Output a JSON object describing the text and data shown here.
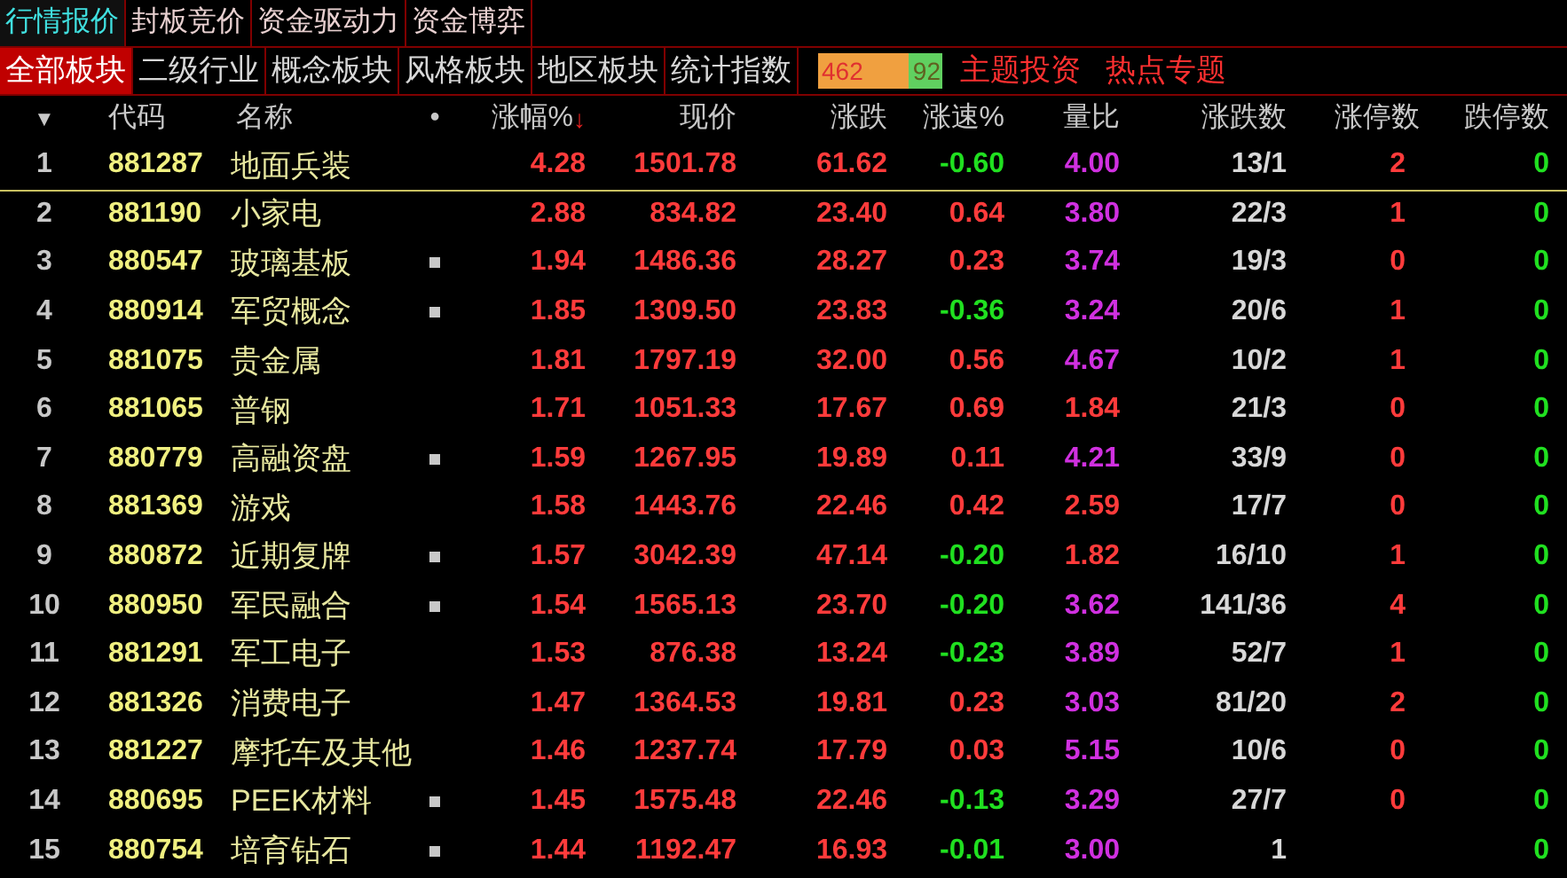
{
  "top_tabs": [
    {
      "label": "行情报价",
      "selected": true
    },
    {
      "label": "封板竞价",
      "selected": false
    },
    {
      "label": "资金驱动力",
      "selected": false
    },
    {
      "label": "资金博弈",
      "selected": false
    }
  ],
  "sector_tabs": [
    {
      "label": "全部板块",
      "selected": true
    },
    {
      "label": "二级行业",
      "selected": false
    },
    {
      "label": "概念板块",
      "selected": false
    },
    {
      "label": "风格板块",
      "selected": false
    },
    {
      "label": "地区板块",
      "selected": false
    },
    {
      "label": "统计指数",
      "selected": false
    }
  ],
  "breadth": {
    "up": "462",
    "down": "92"
  },
  "links": [
    "主题投资",
    "热点专题"
  ],
  "table": {
    "sort_marker": "▼",
    "columns": [
      "代码",
      "名称",
      "•",
      "涨幅%",
      "现价",
      "涨跌",
      "涨速%",
      "量比",
      "涨跌数",
      "涨停数",
      "跌停数"
    ],
    "sort_arrow": "↓",
    "rows": [
      {
        "index": "1",
        "code": "881287",
        "name": "地面兵装",
        "marked": false,
        "selected": true,
        "pct": "4.28",
        "price": "1501.78",
        "change": "61.62",
        "speed": "-0.60",
        "speed_up": false,
        "ratio": "4.00",
        "ratio_high": true,
        "updown": "13/1",
        "limit_up": "2",
        "limit_down": "0"
      },
      {
        "index": "2",
        "code": "881190",
        "name": "小家电",
        "marked": false,
        "selected": false,
        "pct": "2.88",
        "price": "834.82",
        "change": "23.40",
        "speed": "0.64",
        "speed_up": true,
        "ratio": "3.80",
        "ratio_high": true,
        "updown": "22/3",
        "limit_up": "1",
        "limit_down": "0"
      },
      {
        "index": "3",
        "code": "880547",
        "name": "玻璃基板",
        "marked": true,
        "selected": false,
        "pct": "1.94",
        "price": "1486.36",
        "change": "28.27",
        "speed": "0.23",
        "speed_up": true,
        "ratio": "3.74",
        "ratio_high": true,
        "updown": "19/3",
        "limit_up": "0",
        "limit_down": "0"
      },
      {
        "index": "4",
        "code": "880914",
        "name": "军贸概念",
        "marked": true,
        "selected": false,
        "pct": "1.85",
        "price": "1309.50",
        "change": "23.83",
        "speed": "-0.36",
        "speed_up": false,
        "ratio": "3.24",
        "ratio_high": true,
        "updown": "20/6",
        "limit_up": "1",
        "limit_down": "0"
      },
      {
        "index": "5",
        "code": "881075",
        "name": "贵金属",
        "marked": false,
        "selected": false,
        "pct": "1.81",
        "price": "1797.19",
        "change": "32.00",
        "speed": "0.56",
        "speed_up": true,
        "ratio": "4.67",
        "ratio_high": true,
        "updown": "10/2",
        "limit_up": "1",
        "limit_down": "0"
      },
      {
        "index": "6",
        "code": "881065",
        "name": "普钢",
        "marked": false,
        "selected": false,
        "pct": "1.71",
        "price": "1051.33",
        "change": "17.67",
        "speed": "0.69",
        "speed_up": true,
        "ratio": "1.84",
        "ratio_high": false,
        "updown": "21/3",
        "limit_up": "0",
        "limit_down": "0"
      },
      {
        "index": "7",
        "code": "880779",
        "name": "高融资盘",
        "marked": true,
        "selected": false,
        "pct": "1.59",
        "price": "1267.95",
        "change": "19.89",
        "speed": "0.11",
        "speed_up": true,
        "ratio": "4.21",
        "ratio_high": true,
        "updown": "33/9",
        "limit_up": "0",
        "limit_down": "0"
      },
      {
        "index": "8",
        "code": "881369",
        "name": "游戏",
        "marked": false,
        "selected": false,
        "pct": "1.58",
        "price": "1443.76",
        "change": "22.46",
        "speed": "0.42",
        "speed_up": true,
        "ratio": "2.59",
        "ratio_high": false,
        "updown": "17/7",
        "limit_up": "0",
        "limit_down": "0"
      },
      {
        "index": "9",
        "code": "880872",
        "name": "近期复牌",
        "marked": true,
        "selected": false,
        "pct": "1.57",
        "price": "3042.39",
        "change": "47.14",
        "speed": "-0.20",
        "speed_up": false,
        "ratio": "1.82",
        "ratio_high": false,
        "updown": "16/10",
        "limit_up": "1",
        "limit_down": "0"
      },
      {
        "index": "10",
        "code": "880950",
        "name": "军民融合",
        "marked": true,
        "selected": false,
        "pct": "1.54",
        "price": "1565.13",
        "change": "23.70",
        "speed": "-0.20",
        "speed_up": false,
        "ratio": "3.62",
        "ratio_high": true,
        "updown": "141/36",
        "limit_up": "4",
        "limit_down": "0"
      },
      {
        "index": "11",
        "code": "881291",
        "name": "军工电子",
        "marked": false,
        "selected": false,
        "pct": "1.53",
        "price": "876.38",
        "change": "13.24",
        "speed": "-0.23",
        "speed_up": false,
        "ratio": "3.89",
        "ratio_high": true,
        "updown": "52/7",
        "limit_up": "1",
        "limit_down": "0"
      },
      {
        "index": "12",
        "code": "881326",
        "name": "消费电子",
        "marked": false,
        "selected": false,
        "pct": "1.47",
        "price": "1364.53",
        "change": "19.81",
        "speed": "0.23",
        "speed_up": true,
        "ratio": "3.03",
        "ratio_high": true,
        "updown": "81/20",
        "limit_up": "2",
        "limit_down": "0"
      },
      {
        "index": "13",
        "code": "881227",
        "name": "摩托车及其他",
        "marked": false,
        "selected": false,
        "pct": "1.46",
        "price": "1237.74",
        "change": "17.79",
        "speed": "0.03",
        "speed_up": true,
        "ratio": "5.15",
        "ratio_high": true,
        "updown": "10/6",
        "limit_up": "0",
        "limit_down": "0"
      },
      {
        "index": "14",
        "code": "880695",
        "name": "PEEK材料",
        "marked": true,
        "selected": false,
        "pct": "1.45",
        "price": "1575.48",
        "change": "22.46",
        "speed": "-0.13",
        "speed_up": false,
        "ratio": "3.29",
        "ratio_high": true,
        "updown": "27/7",
        "limit_up": "0",
        "limit_down": "0"
      },
      {
        "index": "15",
        "code": "880754",
        "name": "培育钻石",
        "marked": true,
        "selected": false,
        "pct": "1.44",
        "price": "1192.47",
        "change": "16.93",
        "speed": "-0.01",
        "speed_up": false,
        "ratio": "3.00",
        "ratio_high": true,
        "updown": "1",
        "limit_down": "0"
      }
    ]
  }
}
